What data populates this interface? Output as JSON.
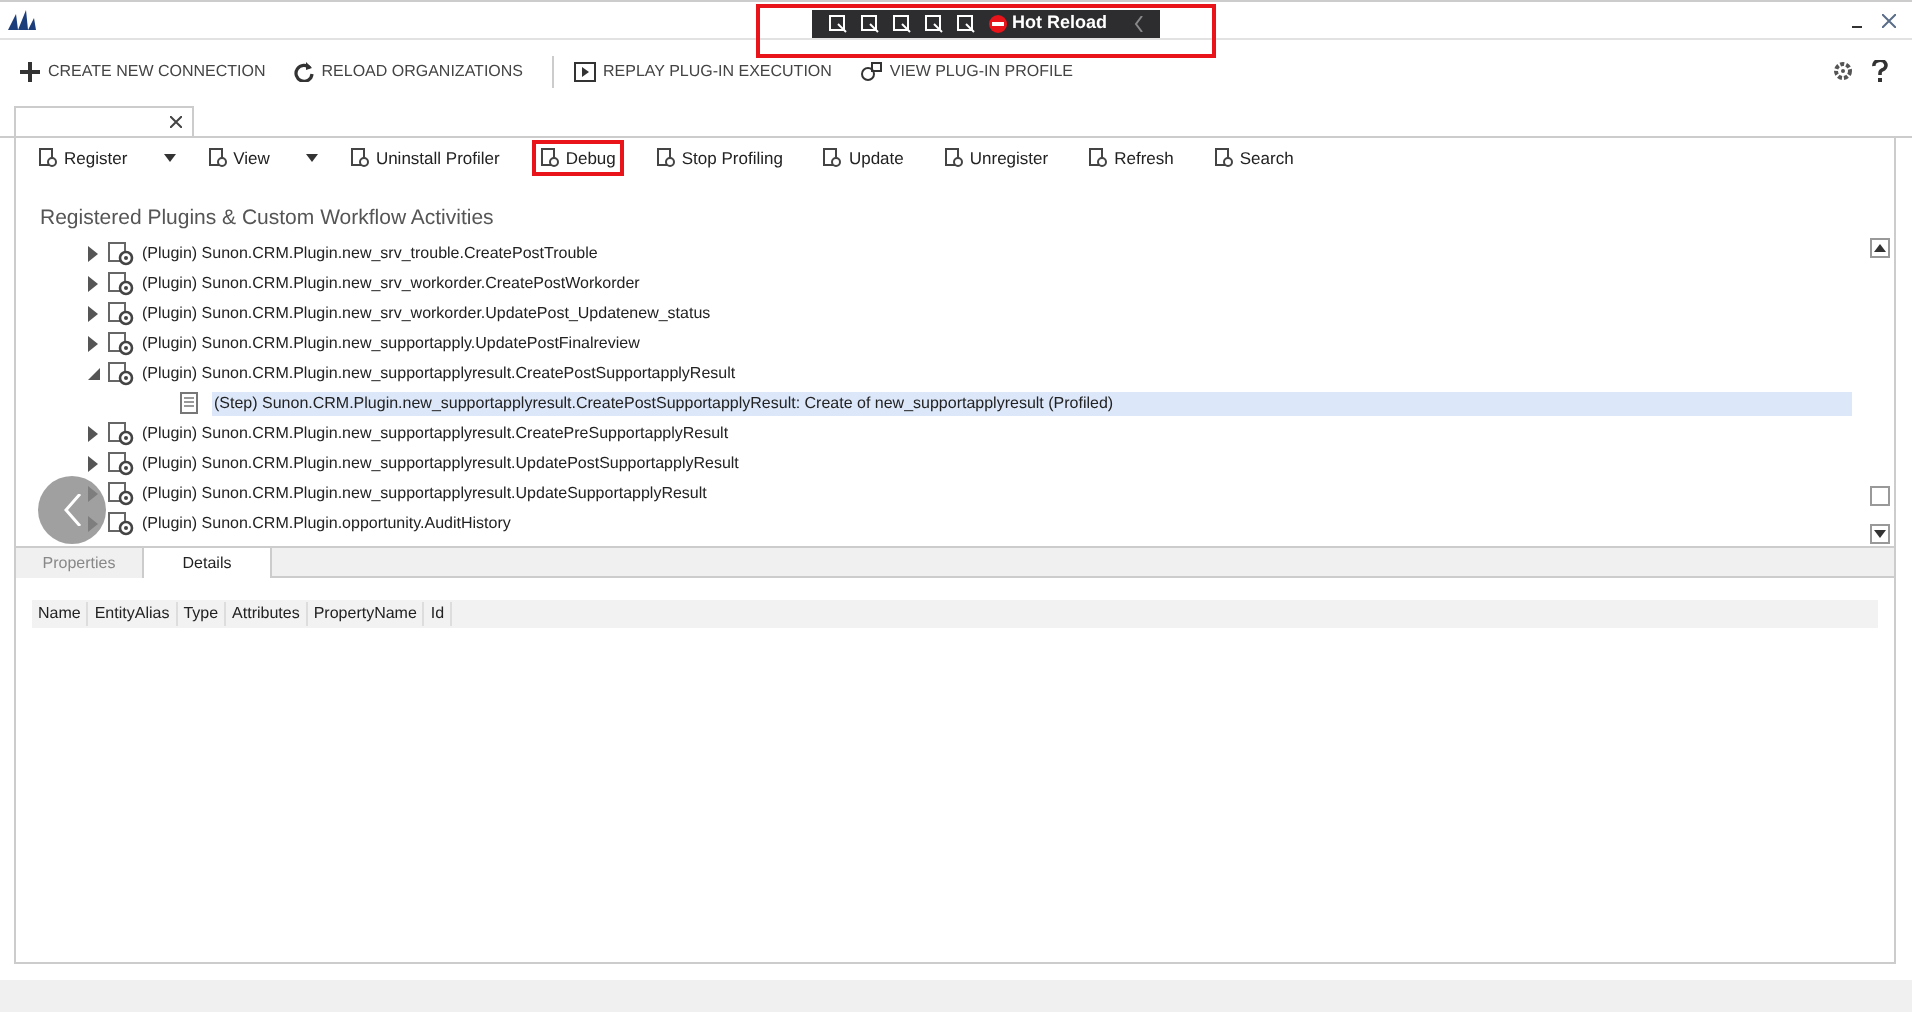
{
  "devtools_bar": {
    "label": "Hot Reload",
    "highlighted": true
  },
  "command_bar": [
    {
      "kind": "plus",
      "label": "CREATE NEW CONNECTION"
    },
    {
      "kind": "reload",
      "label": "RELOAD ORGANIZATIONS"
    },
    {
      "kind": "replay",
      "label": "REPLAY PLUG-IN EXECUTION"
    },
    {
      "kind": "profile",
      "label": "VIEW PLUG-IN PROFILE"
    }
  ],
  "toolbar": [
    {
      "label": "Register",
      "dropdown": true,
      "highlighted": false
    },
    {
      "label": "View",
      "dropdown": true,
      "highlighted": false
    },
    {
      "label": "Uninstall Profiler",
      "dropdown": false,
      "highlighted": false
    },
    {
      "label": "Debug",
      "dropdown": false,
      "highlighted": true
    },
    {
      "label": "Stop Profiling",
      "dropdown": false,
      "highlighted": false
    },
    {
      "label": "Update",
      "dropdown": false,
      "highlighted": false
    },
    {
      "label": "Unregister",
      "dropdown": false,
      "highlighted": false
    },
    {
      "label": "Refresh",
      "dropdown": false,
      "highlighted": false
    },
    {
      "label": "Search",
      "dropdown": false,
      "highlighted": false
    }
  ],
  "heading": "Registered Plugins & Custom Workflow Activities",
  "tree": [
    {
      "label": "(Plugin) Sunon.CRM.Plugin.new_srv_trouble.CreatePostTrouble",
      "expanded": false
    },
    {
      "label": "(Plugin) Sunon.CRM.Plugin.new_srv_workorder.CreatePostWorkorder",
      "expanded": false
    },
    {
      "label": "(Plugin) Sunon.CRM.Plugin.new_srv_workorder.UpdatePost_Updatenew_status",
      "expanded": false
    },
    {
      "label": "(Plugin) Sunon.CRM.Plugin.new_supportapply.UpdatePostFinalreview",
      "expanded": false
    },
    {
      "label": "(Plugin) Sunon.CRM.Plugin.new_supportapplyresult.CreatePostSupportapplyResult",
      "expanded": true,
      "children": [
        {
          "label": "(Step) Sunon.CRM.Plugin.new_supportapplyresult.CreatePostSupportapplyResult: Create of new_supportapplyresult (Profiled)",
          "selected": true
        }
      ]
    },
    {
      "label": "(Plugin) Sunon.CRM.Plugin.new_supportapplyresult.CreatePreSupportapplyResult",
      "expanded": false
    },
    {
      "label": "(Plugin) Sunon.CRM.Plugin.new_supportapplyresult.UpdatePostSupportapplyResult",
      "expanded": false
    },
    {
      "label": "(Plugin) Sunon.CRM.Plugin.new_supportapplyresult.UpdateSupportapplyResult",
      "expanded": false
    },
    {
      "label": "(Plugin) Sunon.CRM.Plugin.opportunity.AuditHistory",
      "expanded": false
    }
  ],
  "detail_tabs": [
    {
      "label": "Properties",
      "selected": false
    },
    {
      "label": "Details",
      "selected": true
    }
  ],
  "columns": [
    "Name",
    "EntityAlias",
    "Type",
    "Attributes",
    "PropertyName",
    "Id"
  ]
}
